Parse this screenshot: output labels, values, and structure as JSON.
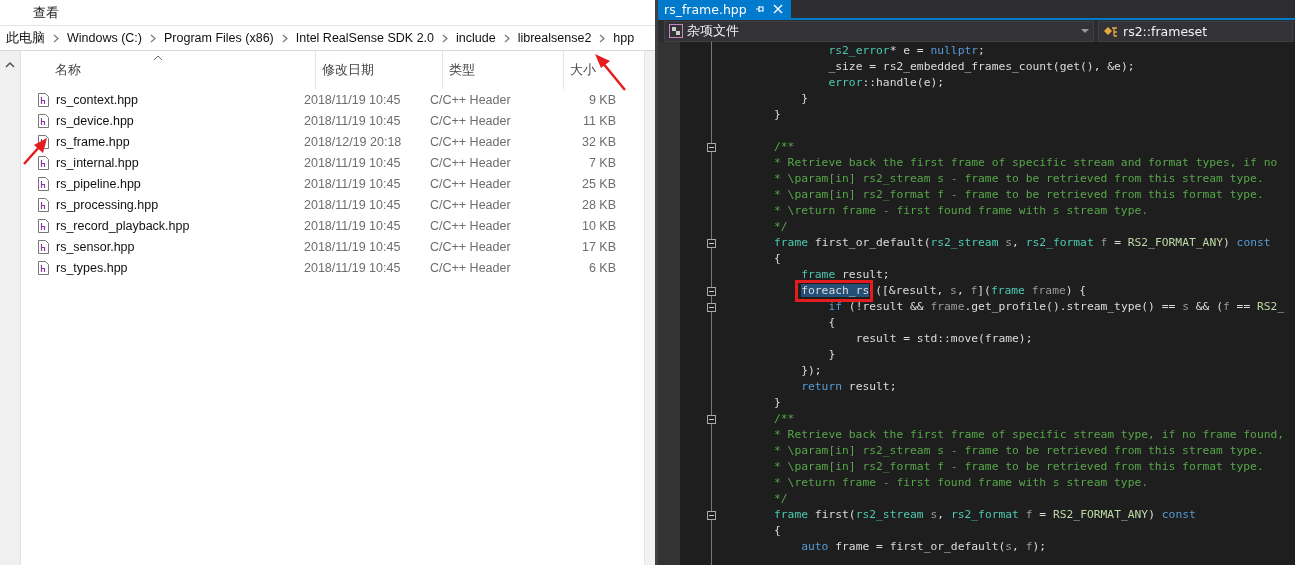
{
  "explorer": {
    "menu": [
      "查看"
    ],
    "breadcrumb": [
      "此电脑",
      "Windows (C:)",
      "Program Files (x86)",
      "Intel RealSense SDK 2.0",
      "include",
      "librealsense2",
      "hpp"
    ],
    "columns": [
      "名称",
      "修改日期",
      "类型",
      "大小"
    ],
    "files": [
      {
        "name": "rs_context.hpp",
        "date": "2018/11/19 10:45",
        "type": "C/C++ Header",
        "size": "9 KB"
      },
      {
        "name": "rs_device.hpp",
        "date": "2018/11/19 10:45",
        "type": "C/C++ Header",
        "size": "11 KB"
      },
      {
        "name": "rs_frame.hpp",
        "date": "2018/12/19 20:18",
        "type": "C/C++ Header",
        "size": "32 KB"
      },
      {
        "name": "rs_internal.hpp",
        "date": "2018/11/19 10:45",
        "type": "C/C++ Header",
        "size": "7 KB"
      },
      {
        "name": "rs_pipeline.hpp",
        "date": "2018/11/19 10:45",
        "type": "C/C++ Header",
        "size": "25 KB"
      },
      {
        "name": "rs_processing.hpp",
        "date": "2018/11/19 10:45",
        "type": "C/C++ Header",
        "size": "28 KB"
      },
      {
        "name": "rs_record_playback.hpp",
        "date": "2018/11/19 10:45",
        "type": "C/C++ Header",
        "size": "10 KB"
      },
      {
        "name": "rs_sensor.hpp",
        "date": "2018/11/19 10:45",
        "type": "C/C++ Header",
        "size": "17 KB"
      },
      {
        "name": "rs_types.hpp",
        "date": "2018/11/19 10:45",
        "type": "C/C++ Header",
        "size": "6 KB"
      }
    ]
  },
  "editor": {
    "tab": {
      "title": "rs_frame.hpp"
    },
    "project": "杂项文件",
    "scope": "rs2::frameset",
    "lines": [
      {
        "fold": false,
        "tokens": [
          {
            "t": "        rs2_error",
            "kind": "type"
          },
          {
            "t": "* e = ",
            "kind": "plain"
          },
          {
            "t": "nullptr",
            "kind": "keyword"
          },
          {
            "t": ";",
            "kind": "plain"
          }
        ]
      },
      {
        "fold": false,
        "tokens": [
          {
            "t": "        _size = rs2_embedded_frames_count(get(), &e);",
            "kind": "plain"
          }
        ]
      },
      {
        "fold": false,
        "tokens": [
          {
            "t": "        error",
            "kind": "type"
          },
          {
            "t": "::handle(e);",
            "kind": "plain"
          }
        ]
      },
      {
        "fold": false,
        "tokens": [
          {
            "t": "    }",
            "kind": "plain"
          }
        ]
      },
      {
        "fold": false,
        "tokens": [
          {
            "t": "}",
            "kind": "plain"
          }
        ]
      },
      {
        "fold": false
      },
      {
        "fold": true,
        "tokens": [
          {
            "t": "/**",
            "kind": "comment"
          }
        ]
      },
      {
        "fold": false,
        "tokens": [
          {
            "t": "* Retrieve back the first frame of specific stream and format types, if no",
            "kind": "comment"
          }
        ]
      },
      {
        "fold": false,
        "tokens": [
          {
            "t": "* \\param[in] rs2_stream s - frame to be retrieved from this stream type.",
            "kind": "comment"
          }
        ]
      },
      {
        "fold": false,
        "tokens": [
          {
            "t": "* \\param[in] rs2_format f - frame to be retrieved from this format type.",
            "kind": "comment"
          }
        ]
      },
      {
        "fold": false,
        "tokens": [
          {
            "t": "* \\return frame - first found frame with s stream type.",
            "kind": "comment"
          }
        ]
      },
      {
        "fold": false,
        "tokens": [
          {
            "t": "*/",
            "kind": "comment"
          }
        ]
      },
      {
        "fold": true,
        "tokens": [
          {
            "t": "frame",
            "kind": "type"
          },
          {
            "t": " first_or_default(",
            "kind": "plain"
          },
          {
            "t": "rs2_stream",
            "kind": "type"
          },
          {
            "t": " s",
            "kind": "param"
          },
          {
            "t": ", ",
            "kind": "plain"
          },
          {
            "t": "rs2_format",
            "kind": "type"
          },
          {
            "t": " f",
            "kind": "param"
          },
          {
            "t": " = ",
            "kind": "plain"
          },
          {
            "t": "RS2_FORMAT_ANY",
            "kind": "macro"
          },
          {
            "t": ") ",
            "kind": "plain"
          },
          {
            "t": "const",
            "kind": "keyword"
          }
        ]
      },
      {
        "fold": false,
        "tokens": [
          {
            "t": "{",
            "kind": "plain"
          }
        ]
      },
      {
        "fold": false,
        "tokens": [
          {
            "t": "    frame",
            "kind": "type"
          },
          {
            "t": " result;",
            "kind": "plain"
          }
        ]
      },
      {
        "fold": true,
        "tokens": [
          {
            "t": "    foreach_rs",
            "kind": "selection"
          },
          {
            "t": "([&result, ",
            "kind": "plain"
          },
          {
            "t": "s",
            "kind": "param"
          },
          {
            "t": ", ",
            "kind": "plain"
          },
          {
            "t": "f",
            "kind": "param"
          },
          {
            "t": "](",
            "kind": "plain"
          },
          {
            "t": "frame",
            "kind": "type"
          },
          {
            "t": " frame",
            "kind": "param"
          },
          {
            "t": ") {",
            "kind": "plain"
          }
        ]
      },
      {
        "fold": true,
        "tokens": [
          {
            "t": "        if",
            "kind": "keyword"
          },
          {
            "t": " (!result && ",
            "kind": "plain"
          },
          {
            "t": "frame",
            "kind": "param"
          },
          {
            "t": ".get_profile().stream_type() == ",
            "kind": "plain"
          },
          {
            "t": "s",
            "kind": "param"
          },
          {
            "t": " && (",
            "kind": "plain"
          },
          {
            "t": "f",
            "kind": "param"
          },
          {
            "t": " == ",
            "kind": "plain"
          },
          {
            "t": "RS2_",
            "kind": "macro"
          }
        ]
      },
      {
        "fold": false,
        "tokens": [
          {
            "t": "        {",
            "kind": "plain"
          }
        ]
      },
      {
        "fold": false,
        "tokens": [
          {
            "t": "            result = std::move(frame);",
            "kind": "plain"
          }
        ]
      },
      {
        "fold": false,
        "tokens": [
          {
            "t": "        }",
            "kind": "plain"
          }
        ]
      },
      {
        "fold": false,
        "tokens": [
          {
            "t": "    });",
            "kind": "plain"
          }
        ]
      },
      {
        "fold": false,
        "tokens": [
          {
            "t": "    return",
            "kind": "keyword"
          },
          {
            "t": " result;",
            "kind": "plain"
          }
        ]
      },
      {
        "fold": false,
        "tokens": [
          {
            "t": "}",
            "kind": "plain"
          }
        ]
      },
      {
        "fold": true,
        "tokens": [
          {
            "t": "/**",
            "kind": "comment"
          }
        ]
      },
      {
        "fold": false,
        "tokens": [
          {
            "t": "* Retrieve back the first frame of specific stream type, if no frame found,",
            "kind": "comment"
          }
        ]
      },
      {
        "fold": false,
        "tokens": [
          {
            "t": "* \\param[in] rs2_stream s - frame to be retrieved from this stream type.",
            "kind": "comment"
          }
        ]
      },
      {
        "fold": false,
        "tokens": [
          {
            "t": "* \\param[in] rs2_format f - frame to be retrieved from this format type.",
            "kind": "comment"
          }
        ]
      },
      {
        "fold": false,
        "tokens": [
          {
            "t": "* \\return frame - first found frame with s stream type.",
            "kind": "comment"
          }
        ]
      },
      {
        "fold": false,
        "tokens": [
          {
            "t": "*/",
            "kind": "comment"
          }
        ]
      },
      {
        "fold": true,
        "tokens": [
          {
            "t": "frame",
            "kind": "type"
          },
          {
            "t": " first(",
            "kind": "plain"
          },
          {
            "t": "rs2_stream",
            "kind": "type"
          },
          {
            "t": " s",
            "kind": "param"
          },
          {
            "t": ", ",
            "kind": "plain"
          },
          {
            "t": "rs2_format",
            "kind": "type"
          },
          {
            "t": " f",
            "kind": "param"
          },
          {
            "t": " = ",
            "kind": "plain"
          },
          {
            "t": "RS2_FORMAT_ANY",
            "kind": "macro"
          },
          {
            "t": ") ",
            "kind": "plain"
          },
          {
            "t": "const",
            "kind": "keyword"
          }
        ]
      },
      {
        "fold": false,
        "tokens": [
          {
            "t": "{",
            "kind": "plain"
          }
        ]
      },
      {
        "fold": false,
        "tokens": [
          {
            "t": "    auto",
            "kind": "keyword"
          },
          {
            "t": " frame = first_or_default(",
            "kind": "plain"
          },
          {
            "t": "s",
            "kind": "param"
          },
          {
            "t": ", ",
            "kind": "plain"
          },
          {
            "t": "f",
            "kind": "param"
          },
          {
            "t": ");",
            "kind": "plain"
          }
        ]
      }
    ]
  }
}
